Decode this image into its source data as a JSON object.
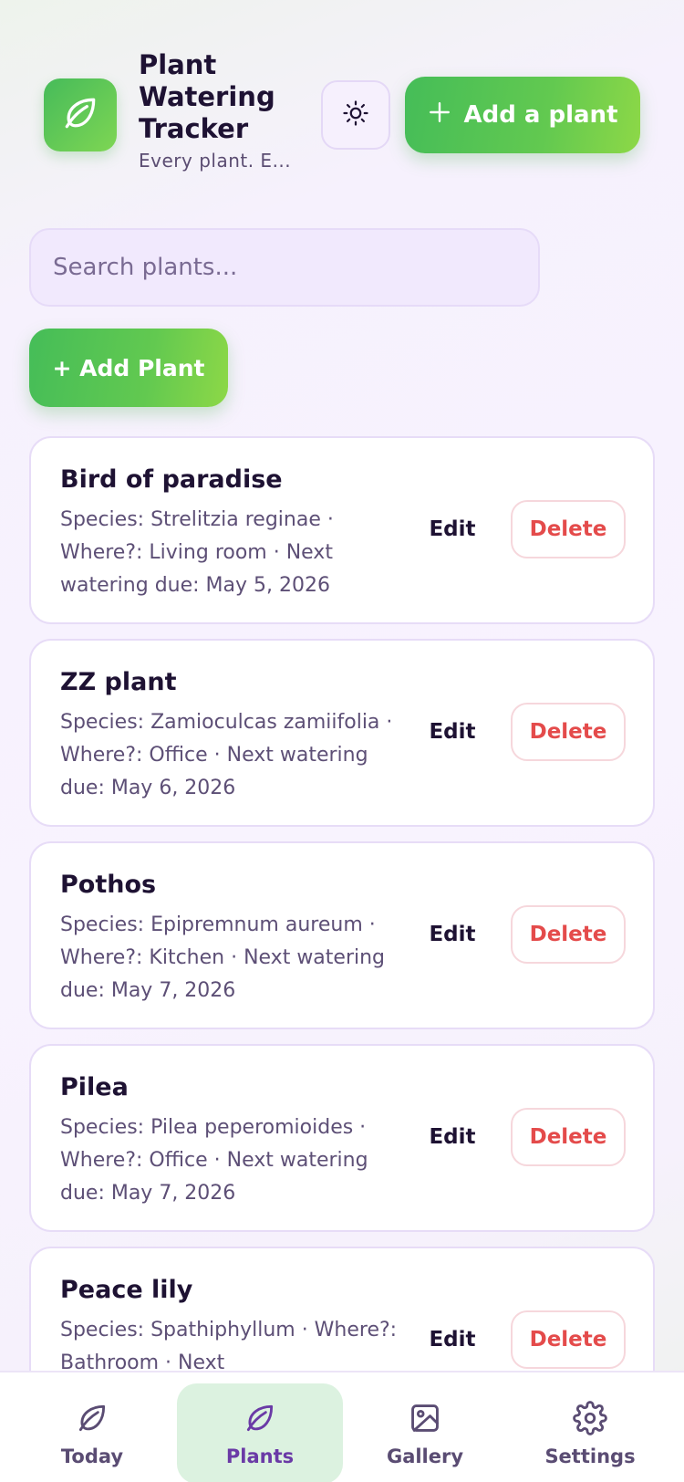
{
  "header": {
    "app_title": "Plant Watering Tracker",
    "tagline": "Every plant. E...",
    "logo_icon": "leaf-icon",
    "theme_icon": "sun-icon",
    "add_button_label": "Add a plant"
  },
  "search": {
    "placeholder": "Search plants..."
  },
  "toolbar": {
    "add_plant_label": "+ Add Plant"
  },
  "plants": [
    {
      "name": "Bird of paradise",
      "meta": "Species: Strelitzia reginae · Where?: Living room · Next watering due: May 5, 2026",
      "edit_label": "Edit",
      "delete_label": "Delete"
    },
    {
      "name": "ZZ plant",
      "meta": "Species: Zamioculcas zamiifolia · Where?: Office · Next watering due: May 6, 2026",
      "edit_label": "Edit",
      "delete_label": "Delete"
    },
    {
      "name": "Pothos",
      "meta": "Species: Epipremnum aureum · Where?: Kitchen · Next watering due: May 7, 2026",
      "edit_label": "Edit",
      "delete_label": "Delete"
    },
    {
      "name": "Pilea",
      "meta": "Species: Pilea peperomioides · Where?: Office · Next watering due: May 7, 2026",
      "edit_label": "Edit",
      "delete_label": "Delete"
    },
    {
      "name": "Peace lily",
      "meta": "Species: Spathiphyllum · Where?: Bathroom · Next",
      "edit_label": "Edit",
      "delete_label": "Delete"
    }
  ],
  "nav": {
    "items": [
      {
        "label": "Today",
        "icon": "leaf-icon",
        "active": false
      },
      {
        "label": "Plants",
        "icon": "leaf-icon",
        "active": true
      },
      {
        "label": "Gallery",
        "icon": "image-icon",
        "active": false
      },
      {
        "label": "Settings",
        "icon": "gear-icon",
        "active": false
      }
    ]
  },
  "colors": {
    "accent_green": "#5cc552",
    "accent_purple": "#6a3aa6",
    "danger": "#e44b4b",
    "active_tab_bg": "#dcf2e0"
  }
}
